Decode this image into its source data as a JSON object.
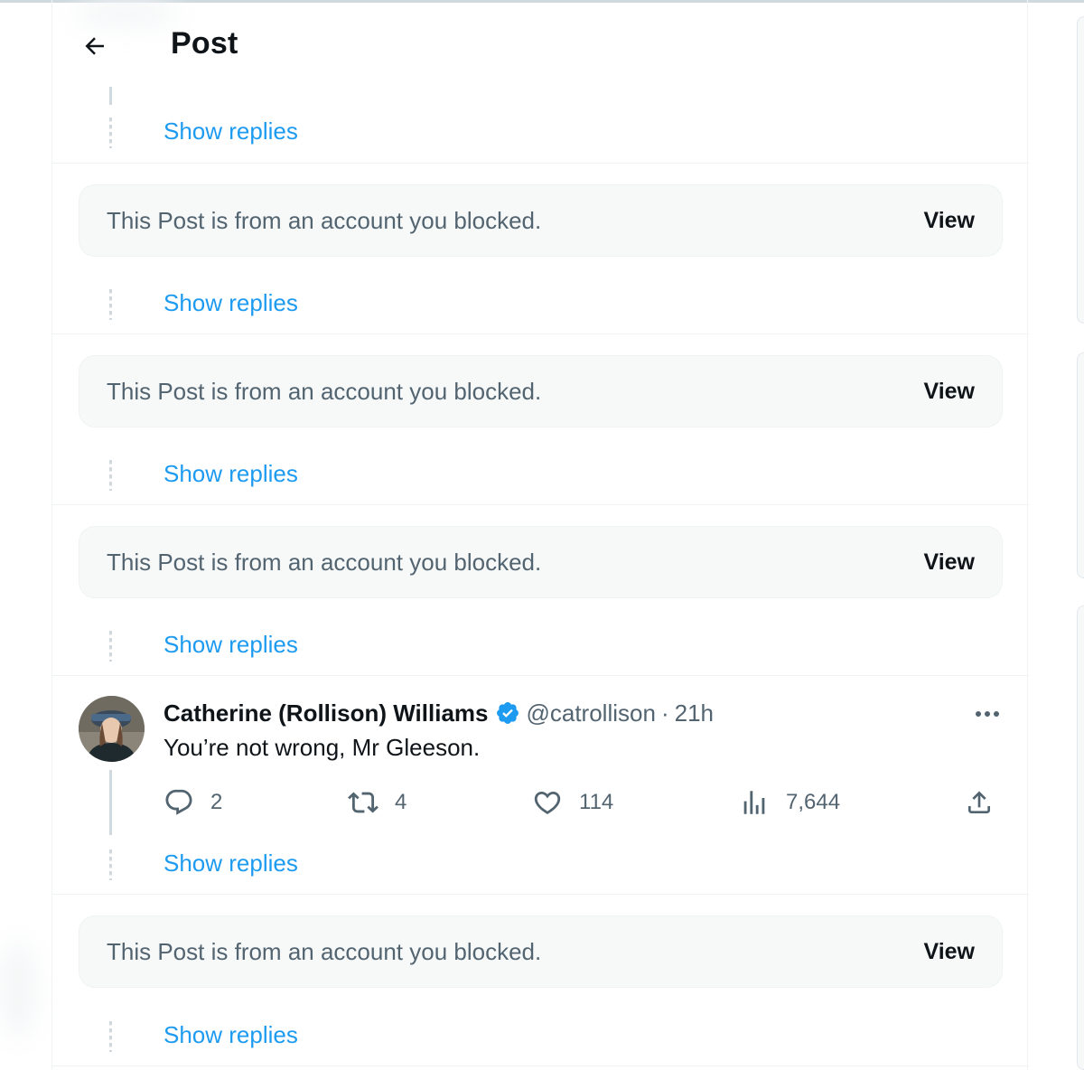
{
  "header": {
    "title": "Post"
  },
  "show_replies_label": "Show replies",
  "blocked": {
    "message": "This Post is from an account you blocked.",
    "view_label": "View"
  },
  "tweet": {
    "author_name": "Catherine (Rollison) Williams",
    "handle": "@catrollison",
    "separator": "·",
    "time": "21h",
    "text": "You’re not wrong, Mr Gleeson.",
    "replies": "2",
    "reposts": "4",
    "likes": "114",
    "views": "7,644"
  },
  "colors": {
    "accent": "#1d9bf0",
    "card_bg": "#f7f9f9",
    "muted_text": "#536471",
    "verified": "#1d9bf0"
  },
  "icons": [
    "back-arrow-icon",
    "verified-badge-icon",
    "more-icon",
    "reply-icon",
    "repost-icon",
    "like-icon",
    "views-icon",
    "share-icon"
  ]
}
